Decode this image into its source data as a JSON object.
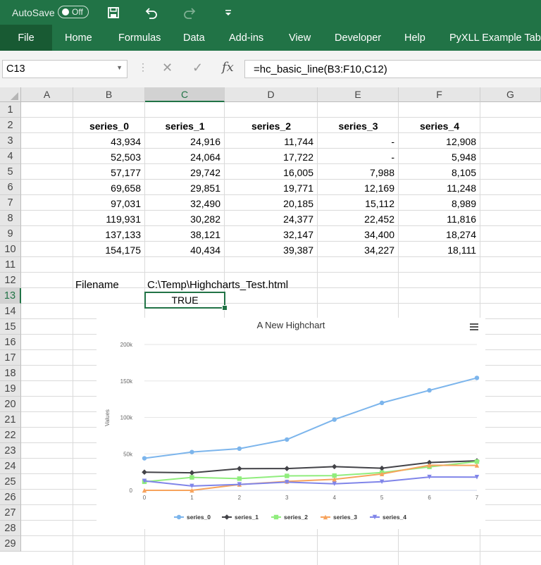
{
  "titlebar": {
    "autosave_label": "AutoSave",
    "autosave_state": "Off",
    "bg_color": "#217346"
  },
  "ribbon": {
    "tabs": [
      {
        "label": "File",
        "active": true
      },
      {
        "label": "Home"
      },
      {
        "label": "Formulas"
      },
      {
        "label": "Data"
      },
      {
        "label": "Add-ins"
      },
      {
        "label": "View"
      },
      {
        "label": "Developer"
      },
      {
        "label": "Help"
      },
      {
        "label": "PyXLL Example Tab"
      }
    ]
  },
  "formula_bar": {
    "name_box": "C13",
    "formula": "=hc_basic_line(B3:F10,C12)"
  },
  "columns": [
    "A",
    "B",
    "C",
    "D",
    "E",
    "F",
    "G"
  ],
  "rows": [
    "1",
    "2",
    "3",
    "4",
    "5",
    "6",
    "7",
    "8",
    "9",
    "10",
    "11",
    "12",
    "13",
    "14",
    "15",
    "16",
    "17",
    "18",
    "19",
    "20",
    "21",
    "22",
    "23",
    "24",
    "25",
    "26",
    "27",
    "28",
    "29"
  ],
  "selected": {
    "column": "C",
    "row": "13"
  },
  "table": {
    "headers": [
      "series_0",
      "series_1",
      "series_2",
      "series_3",
      "series_4"
    ],
    "rows": [
      [
        "43,934",
        "24,916",
        "11,744",
        "-",
        "12,908"
      ],
      [
        "52,503",
        "24,064",
        "17,722",
        "-",
        "5,948"
      ],
      [
        "57,177",
        "29,742",
        "16,005",
        "7,988",
        "8,105"
      ],
      [
        "69,658",
        "29,851",
        "19,771",
        "12,169",
        "11,248"
      ],
      [
        "97,031",
        "32,490",
        "20,185",
        "15,112",
        "8,989"
      ],
      [
        "119,931",
        "30,282",
        "24,377",
        "22,452",
        "11,816"
      ],
      [
        "137,133",
        "38,121",
        "32,147",
        "34,400",
        "18,274"
      ],
      [
        "154,175",
        "40,434",
        "39,387",
        "34,227",
        "18,111"
      ]
    ]
  },
  "filename_label": "Filename",
  "filename_value": "C:\\Temp\\Highcharts_Test.html",
  "result_value": "TRUE",
  "chart_data": {
    "type": "line",
    "title": "A New Highchart",
    "ylabel": "Values",
    "xlabel": "",
    "x": [
      0,
      1,
      2,
      3,
      4,
      5,
      6,
      7
    ],
    "ylim": [
      0,
      200000
    ],
    "yticks": [
      0,
      50000,
      100000,
      150000,
      200000
    ],
    "ytick_labels": [
      "0",
      "50k",
      "100k",
      "150k",
      "200k"
    ],
    "grid": true,
    "legend": "bottom",
    "series": [
      {
        "name": "series_0",
        "color": "#7cb5ec",
        "marker": "circle",
        "values": [
          43934,
          52503,
          57177,
          69658,
          97031,
          119931,
          137133,
          154175
        ]
      },
      {
        "name": "series_1",
        "color": "#434348",
        "marker": "diamond",
        "values": [
          24916,
          24064,
          29742,
          29851,
          32490,
          30282,
          38121,
          40434
        ]
      },
      {
        "name": "series_2",
        "color": "#90ed7d",
        "marker": "square",
        "values": [
          11744,
          17722,
          16005,
          19771,
          20185,
          24377,
          32147,
          39387
        ]
      },
      {
        "name": "series_3",
        "color": "#f7a35c",
        "marker": "triangle",
        "values": [
          0,
          0,
          7988,
          12169,
          15112,
          22452,
          34400,
          34227
        ]
      },
      {
        "name": "series_4",
        "color": "#8085e9",
        "marker": "triangle-down",
        "values": [
          12908,
          5948,
          8105,
          11248,
          8989,
          11816,
          18274,
          18111
        ]
      }
    ]
  }
}
